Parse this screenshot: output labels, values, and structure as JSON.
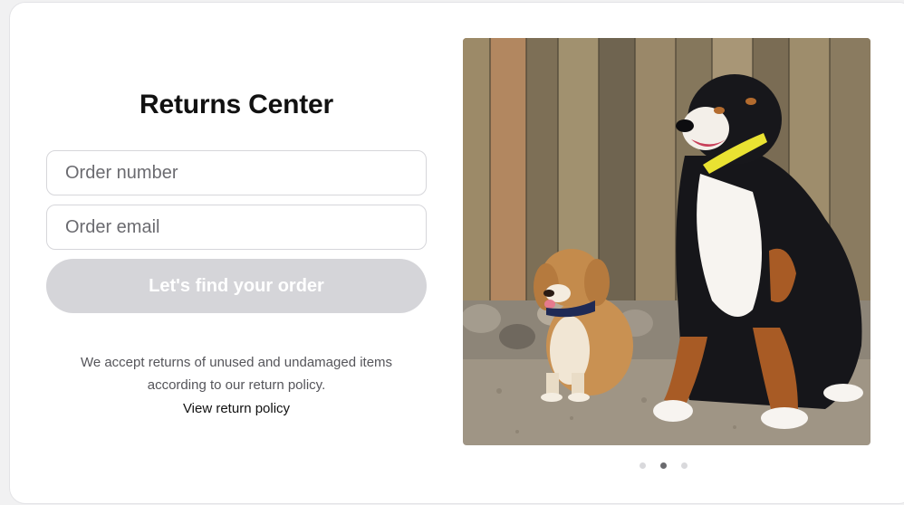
{
  "returns": {
    "title": "Returns Center",
    "order_number_placeholder": "Order number",
    "order_email_placeholder": "Order email",
    "find_button_label": "Let's find your order",
    "note_line1": "We accept returns of unused and undamaged items",
    "note_line2": "according to our return policy.",
    "policy_link_label": "View return policy"
  },
  "carousel": {
    "slide_count": 3,
    "active_index": 1
  },
  "colors": {
    "button_disabled": "#d5d5d9",
    "dot_active": "#6a6a6e",
    "dot_inactive": "#d9d9dc"
  }
}
